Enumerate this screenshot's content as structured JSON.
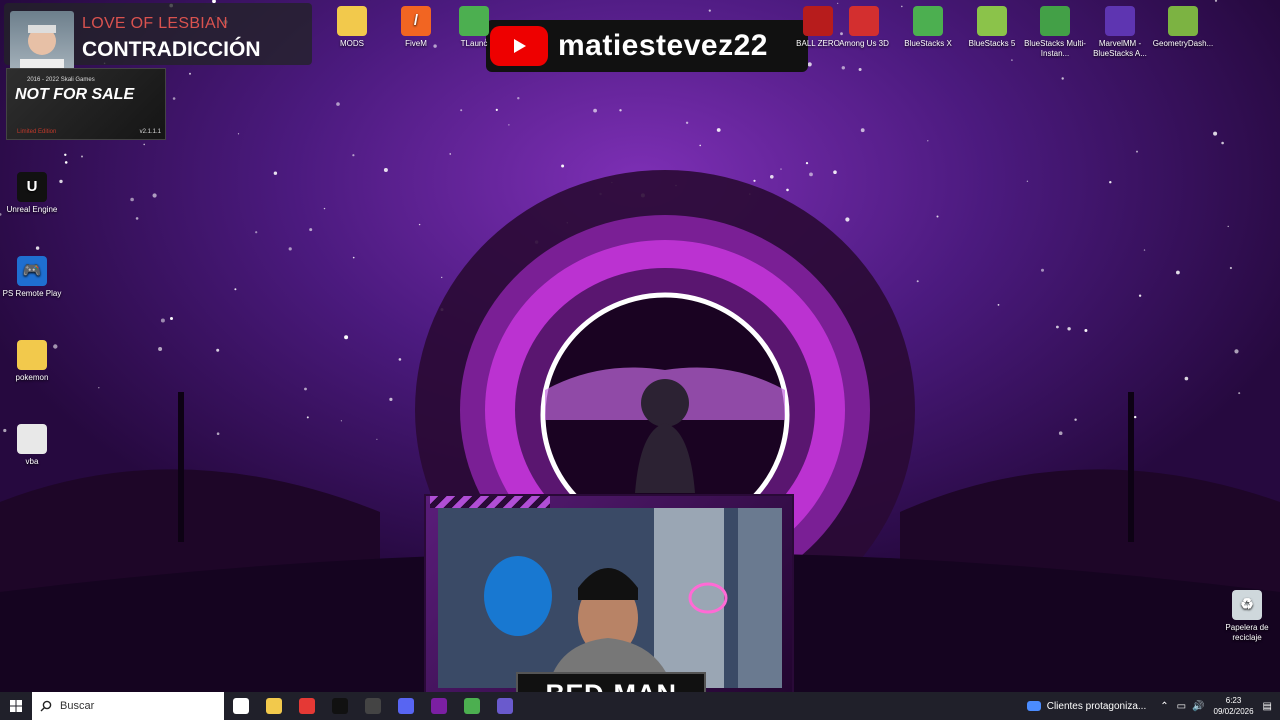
{
  "now_playing": {
    "artist": "LOVE OF LESBIAN",
    "track": "CONTRADICCIÓN"
  },
  "game_widget": {
    "years": "2016 - 2022 Skali Games",
    "title": "NOT FOR SALE",
    "subtitle": "Limited Edition",
    "version": "v2.1.1.1"
  },
  "stream_banner": {
    "handle": "matiestevez22"
  },
  "webcam": {
    "name": "BED-MAN"
  },
  "desktop_icons": {
    "left": [
      {
        "label": "Unreal Engine",
        "icon": "unreal-engine-icon",
        "color": "#111111",
        "glyph": "U"
      },
      {
        "label": "PS Remote Play",
        "icon": "ps-remote-play-icon",
        "color": "#1f6fd1",
        "glyph": "🎮"
      },
      {
        "label": "pokemon",
        "icon": "folder-icon",
        "color": "#f2c94c",
        "glyph": ""
      },
      {
        "label": "vba",
        "icon": "file-icon",
        "color": "#e8e8e8",
        "glyph": ""
      }
    ],
    "top": [
      {
        "label": "MODS",
        "icon": "folder-icon",
        "color": "#f2c94c",
        "glyph": ""
      },
      {
        "label": "FiveM",
        "icon": "fivem-icon",
        "color": "#f26522",
        "glyph": "/"
      },
      {
        "label": "TLaunc",
        "icon": "tlauncher-icon",
        "color": "#4caf50",
        "glyph": ""
      },
      {
        "label": "BALL ZERO",
        "icon": "game-icon",
        "color": "#b71c1c",
        "glyph": ""
      },
      {
        "label": "Among Us 3D",
        "icon": "among-us-icon",
        "color": "#d32f2f",
        "glyph": ""
      },
      {
        "label": "BlueStacks X",
        "icon": "bluestacks-icon",
        "color": "#4caf50",
        "glyph": ""
      },
      {
        "label": "BlueStacks 5",
        "icon": "bluestacks-icon",
        "color": "#8bc34a",
        "glyph": ""
      },
      {
        "label": "BlueStacks Multi-Instan...",
        "icon": "bluestacks-multi-icon",
        "color": "#43a047",
        "glyph": ""
      },
      {
        "label": "MarvelMM - BlueStacks A...",
        "icon": "marvel-icon",
        "color": "#5e35b1",
        "glyph": ""
      },
      {
        "label": "GeometryDash...",
        "icon": "android-icon",
        "color": "#7cb342",
        "glyph": ""
      }
    ],
    "right": [
      {
        "label": "Papelera de reciclaje",
        "icon": "recycle-bin-icon",
        "color": "#cfd8dc",
        "glyph": "♻"
      }
    ]
  },
  "taskbar": {
    "search_placeholder": "Buscar",
    "apps": [
      {
        "name": "task-view",
        "color": "#ffffff"
      },
      {
        "name": "file-explorer",
        "color": "#f2c94c"
      },
      {
        "name": "chrome",
        "color": "#e53935"
      },
      {
        "name": "tiktok",
        "color": "#111111"
      },
      {
        "name": "obs",
        "color": "#444444"
      },
      {
        "name": "discord",
        "color": "#5865f2"
      },
      {
        "name": "winrar",
        "color": "#7b1fa2"
      },
      {
        "name": "minecraft",
        "color": "#4caf50"
      },
      {
        "name": "app",
        "color": "#6a5acd"
      }
    ],
    "notification": "Clientes protagoniza...",
    "time": "6:23",
    "date": "09/02/2026"
  }
}
